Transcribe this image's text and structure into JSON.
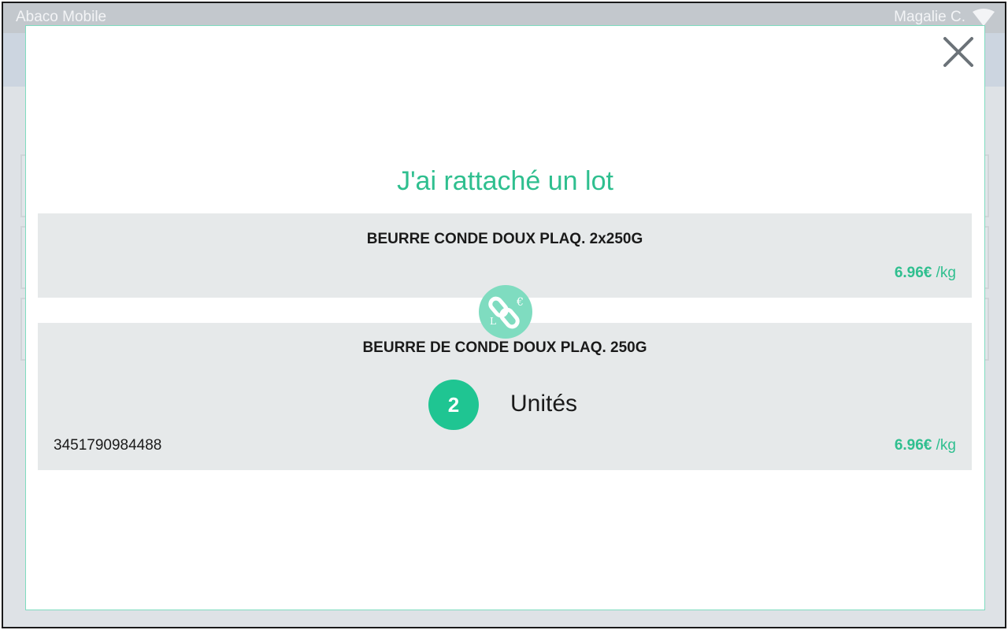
{
  "topbar": {
    "app_title": "Abaco Mobile",
    "user_name": "Magalie C.",
    "wifi_icon": "wifi-icon"
  },
  "modal": {
    "title": "J'ai rattaché un lot",
    "close_icon": "close-icon",
    "link_icon": "link-lot-icon",
    "link_icon_glyphs": {
      "currency": "€",
      "letter": "L"
    },
    "source_product": {
      "name": "BEURRE CONDE DOUX PLAQ. 2x250G",
      "price": "6.96€",
      "unit": "/kg"
    },
    "target_product": {
      "name": "BEURRE DE CONDE DOUX PLAQ. 250G",
      "quantity": "2",
      "quantity_unit": "Unités",
      "barcode": "3451790984488",
      "price": "6.96€",
      "unit": "/kg"
    }
  },
  "colors": {
    "accent": "#2fbf8f",
    "badge": "#1fc592",
    "link_badge": "#7fdcc0",
    "card_bg": "#e6e9ea",
    "topbar": "#b6bcc1"
  }
}
